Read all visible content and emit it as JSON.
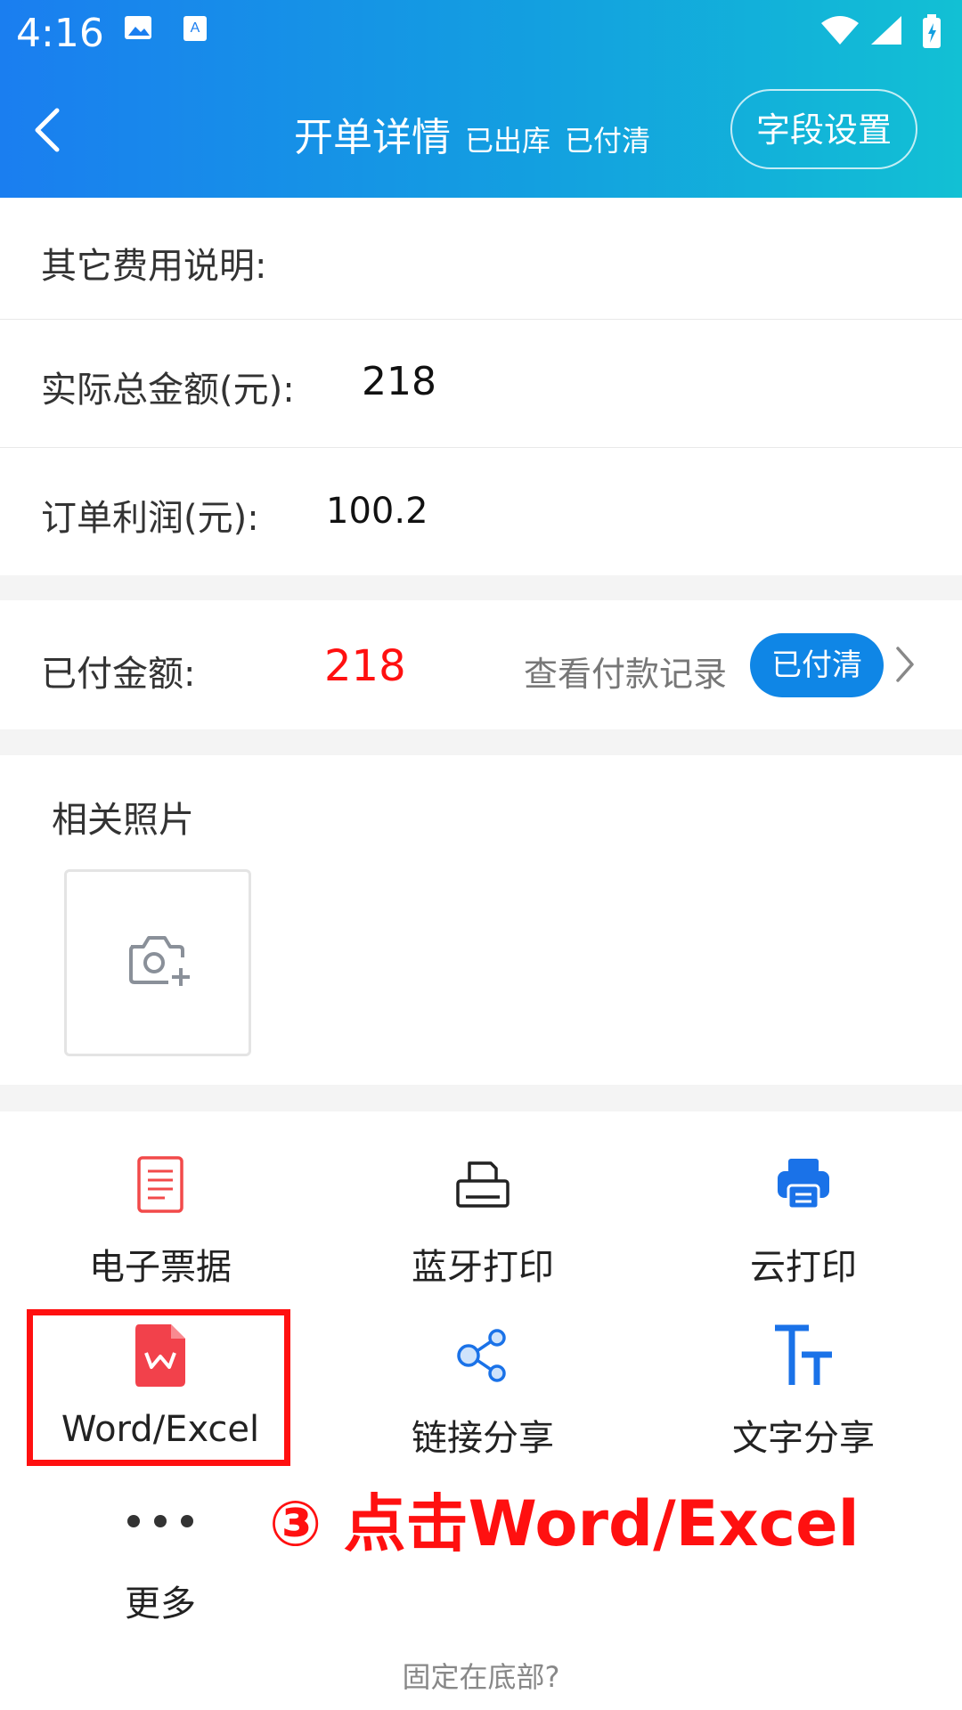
{
  "status_bar": {
    "time": "4:16"
  },
  "header": {
    "title": "开单详情",
    "tag_out": "已出库",
    "tag_paid": "已付清",
    "field_settings_label": "字段设置"
  },
  "rows": {
    "other_fees_label": "其它费用说明:",
    "actual_total_label": "实际总金额(元):",
    "actual_total_value": "218",
    "profit_label": "订单利润(元):",
    "profit_value": "100.2",
    "paid_label": "已付金额:",
    "paid_value": "218",
    "payment_record_link": "查看付款记录",
    "paid_status_badge": "已付清"
  },
  "photos": {
    "title": "相关照片"
  },
  "actions": [
    {
      "label": "电子票据",
      "icon": "receipt-icon"
    },
    {
      "label": "蓝牙打印",
      "icon": "bluetooth-printer-icon"
    },
    {
      "label": "云打印",
      "icon": "cloud-print-icon"
    },
    {
      "label": "Word/Excel",
      "icon": "wps-document-icon"
    },
    {
      "label": "链接分享",
      "icon": "share-icon"
    },
    {
      "label": "文字分享",
      "icon": "text-size-icon"
    },
    {
      "label": "更多",
      "icon": "more-icon"
    }
  ],
  "annotation": "③ 点击Word/Excel",
  "footer": {
    "pin_bottom": "固定在底部?"
  },
  "colors": {
    "header_gradient_start": "#1a7ef0",
    "header_gradient_end": "#12c0d4",
    "accent_blue": "#0f86e6",
    "paid_red": "#ff1010",
    "annotation_red": "#ff1010"
  }
}
